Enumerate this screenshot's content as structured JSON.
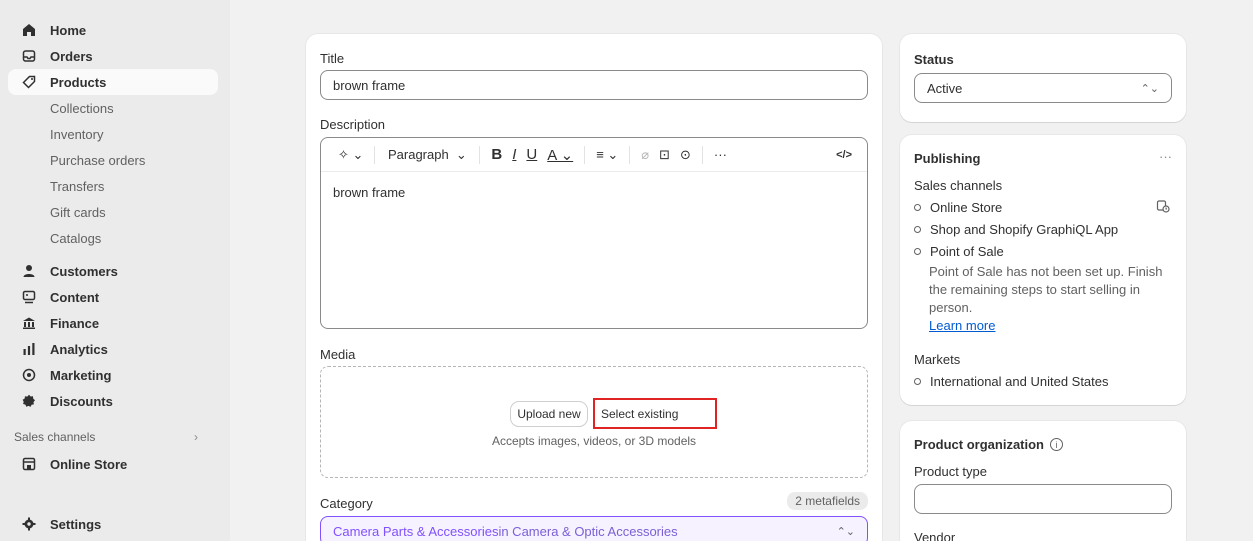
{
  "nav": {
    "home": "Home",
    "orders": "Orders",
    "products": "Products",
    "collections": "Collections",
    "inventory": "Inventory",
    "purchase_orders": "Purchase orders",
    "transfers": "Transfers",
    "gift_cards": "Gift cards",
    "catalogs": "Catalogs",
    "customers": "Customers",
    "content": "Content",
    "finance": "Finance",
    "analytics": "Analytics",
    "marketing": "Marketing",
    "discounts": "Discounts",
    "sales_channels_label": "Sales channels",
    "online_store": "Online Store",
    "settings": "Settings"
  },
  "product": {
    "title_label": "Title",
    "title_value": "brown frame",
    "description_label": "Description",
    "toolbar_paragraph": "Paragraph",
    "description_value": "brown frame",
    "media_label": "Media",
    "upload_button": "Upload new",
    "select_existing_button": "Select existing",
    "media_hint": "Accepts images, videos, or 3D models",
    "category_label": "Category",
    "category_badge": "2 metafields",
    "category_value_main": "Camera Parts & Accessories",
    "category_value_rest": " in Camera & Optic Accessories"
  },
  "status": {
    "label": "Status",
    "value": "Active"
  },
  "publishing": {
    "title": "Publishing",
    "more": "···",
    "sales_channels_label": "Sales channels",
    "channels": [
      "Online Store",
      "Shop and Shopify GraphiQL App",
      "Point of Sale"
    ],
    "pos_note": "Point of Sale has not been set up. Finish the remaining steps to start selling in person.",
    "learn_more": "Learn more",
    "markets_label": "Markets",
    "market": "International and United States"
  },
  "organization": {
    "title": "Product organization",
    "product_type_label": "Product type",
    "product_type_value": "",
    "vendor_label": "Vendor"
  },
  "colors": {
    "accent_purple": "#8051ff",
    "highlight_red": "#e02424",
    "link_blue": "#005bd3"
  }
}
